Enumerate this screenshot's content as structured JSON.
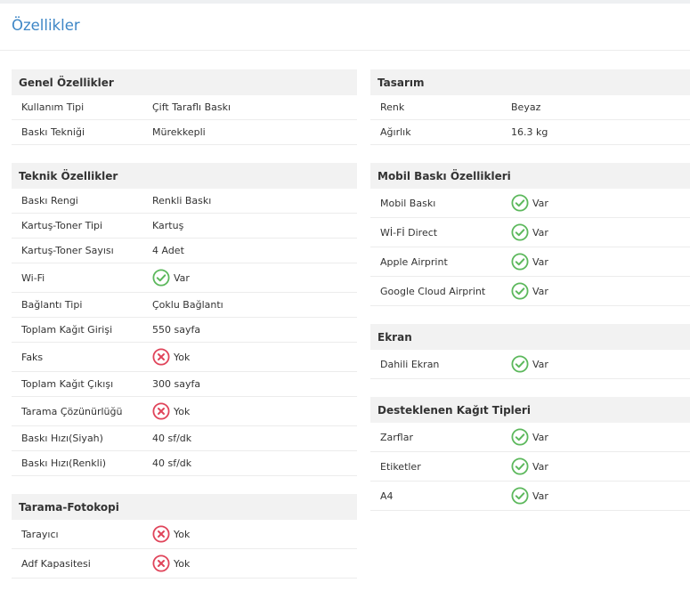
{
  "page": {
    "title": "Özellikler"
  },
  "colors": {
    "title": "#3d86c6",
    "yes": "#5cb85c",
    "no": "#e0445a",
    "header_bg": "#f2f2f2"
  },
  "left_sections": [
    {
      "title": "Genel Özellikler",
      "rows": [
        {
          "label": "Kullanım Tipi",
          "value": "Çift Taraflı Baskı"
        },
        {
          "label": "Baskı Tekniği",
          "value": "Mürekkepli"
        }
      ]
    },
    {
      "title": "Teknik Özellikler",
      "rows": [
        {
          "label": "Baskı Rengi",
          "value": "Renkli Baskı"
        },
        {
          "label": "Kartuş-Toner Tipi",
          "value": "Kartuş"
        },
        {
          "label": "Kartuş-Toner Sayısı",
          "value": "4 Adet"
        },
        {
          "label": "Wi-Fi",
          "value": "Var",
          "icon": "check-circle-icon"
        },
        {
          "label": "Bağlantı Tipi",
          "value": "Çoklu Bağlantı"
        },
        {
          "label": "Toplam Kağıt Girişi",
          "value": "550 sayfa"
        },
        {
          "label": "Faks",
          "value": "Yok",
          "icon": "x-circle-icon"
        },
        {
          "label": "Toplam Kağıt Çıkışı",
          "value": "300 sayfa"
        },
        {
          "label": "Tarama Çözünürlüğü",
          "value": "Yok",
          "icon": "x-circle-icon"
        },
        {
          "label": "Baskı Hızı(Siyah)",
          "value": "40 sf/dk"
        },
        {
          "label": "Baskı Hızı(Renkli)",
          "value": "40 sf/dk"
        }
      ]
    },
    {
      "title": "Tarama-Fotokopi",
      "rows": [
        {
          "label": "Tarayıcı",
          "value": "Yok",
          "icon": "x-circle-icon"
        },
        {
          "label": "Adf Kapasitesi",
          "value": "Yok",
          "icon": "x-circle-icon"
        }
      ]
    }
  ],
  "right_sections": [
    {
      "title": "Tasarım",
      "rows": [
        {
          "label": "Renk",
          "value": "Beyaz"
        },
        {
          "label": "Ağırlık",
          "value": "16.3 kg"
        }
      ]
    },
    {
      "title": "Mobil Baskı Özellikleri",
      "rows": [
        {
          "label": "Mobil Baskı",
          "value": "Var",
          "icon": "check-circle-icon"
        },
        {
          "label": "Wİ-Fİ Direct",
          "value": "Var",
          "icon": "check-circle-icon"
        },
        {
          "label": "Apple Airprint",
          "value": "Var",
          "icon": "check-circle-icon"
        },
        {
          "label": "Google Cloud Airprint",
          "value": "Var",
          "icon": "check-circle-icon"
        }
      ]
    },
    {
      "title": "Ekran",
      "rows": [
        {
          "label": "Dahili Ekran",
          "value": "Var",
          "icon": "check-circle-icon"
        }
      ]
    },
    {
      "title": "Desteklenen Kağıt Tipleri",
      "rows": [
        {
          "label": "Zarflar",
          "value": "Var",
          "icon": "check-circle-icon"
        },
        {
          "label": "Etiketler",
          "value": "Var",
          "icon": "check-circle-icon"
        },
        {
          "label": "A4",
          "value": "Var",
          "icon": "check-circle-icon"
        }
      ]
    }
  ]
}
